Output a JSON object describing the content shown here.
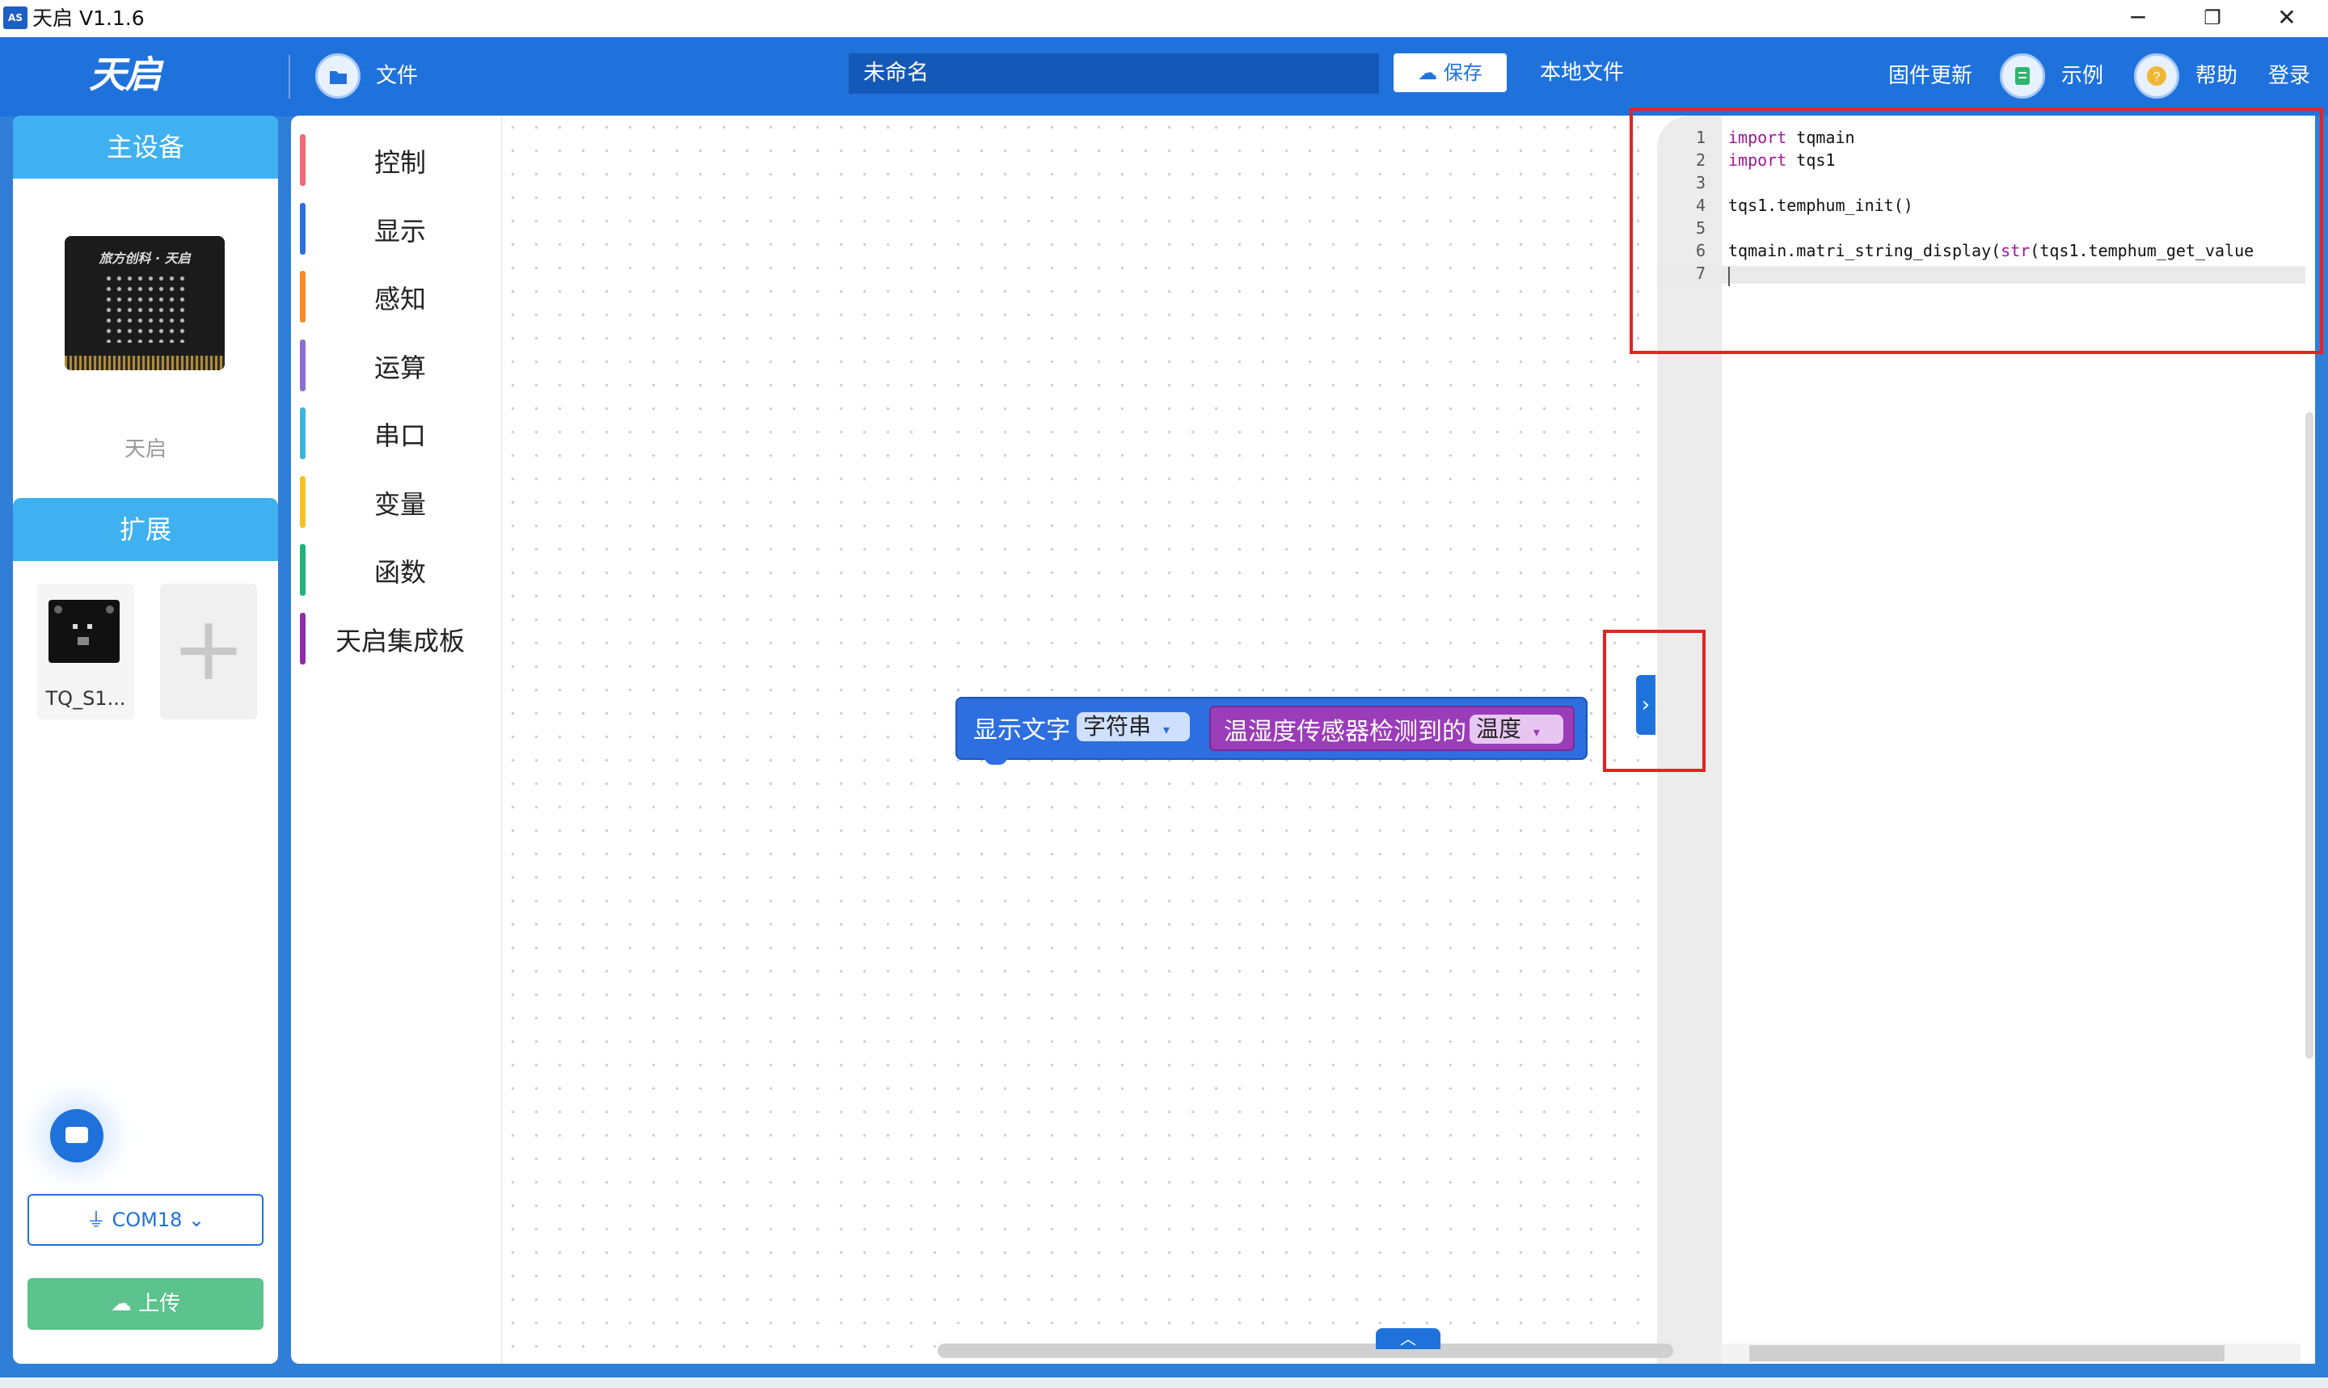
{
  "window": {
    "title": "天启 V1.1.6",
    "controls": {
      "minimize": "─",
      "maximize": "❐",
      "close": "✕"
    }
  },
  "header": {
    "logo": "天启",
    "logo_sub": "",
    "file_menu": "文件",
    "filename": "未命名",
    "save": "保存",
    "local_file": "本地文件",
    "firmware_update": "固件更新",
    "examples": "示例",
    "help": "帮助",
    "login": "登录"
  },
  "main_device": {
    "heading": "主设备",
    "board_brand": "旅方创科 · 天启",
    "name": "天启"
  },
  "extension": {
    "heading": "扩展",
    "items": [
      {
        "name": "TQ_S1..."
      }
    ],
    "add_icon": "+"
  },
  "port": {
    "selected": "COM18",
    "chevron": "⌄"
  },
  "upload": {
    "label": "上传"
  },
  "categories": [
    {
      "label": "控制",
      "color": "#f06a78"
    },
    {
      "label": "显示",
      "color": "#2d6fe0"
    },
    {
      "label": "感知",
      "color": "#f28c28"
    },
    {
      "label": "运算",
      "color": "#8a6fd1"
    },
    {
      "label": "串口",
      "color": "#3cb6d8"
    },
    {
      "label": "变量",
      "color": "#f5c025"
    },
    {
      "label": "函数",
      "color": "#1fb37a"
    },
    {
      "label": "天启集成板",
      "color": "#8e2ea4"
    }
  ],
  "block": {
    "label": "显示文字",
    "type_dropdown": "字符串",
    "value_label": "温湿度传感器检测到的",
    "value_dropdown": "温度",
    "dropdown_arrow": "▾"
  },
  "toggle": {
    "icon": "›"
  },
  "code": {
    "lines": [
      {
        "n": "1",
        "kw": "import",
        "rest": " tqmain"
      },
      {
        "n": "2",
        "kw": "import",
        "rest": " tqs1"
      },
      {
        "n": "3",
        "kw": "",
        "rest": ""
      },
      {
        "n": "4",
        "kw": "",
        "rest": "tqs1.temphum_init()"
      },
      {
        "n": "5",
        "kw": "",
        "rest": ""
      },
      {
        "n": "6",
        "kw": "",
        "rest": "tqmain.matri_string_display(",
        "kw2": "str",
        "rest2": "(tqs1.temphum_get_value"
      },
      {
        "n": "7",
        "kw": "",
        "rest": ""
      }
    ]
  },
  "workspace": {
    "scroll_up_icon": "︿"
  },
  "colors": {
    "header_bg": "#1f72dc",
    "accent": "#3fb1f0",
    "upload_green": "#5cc28e",
    "highlight_red": "#e52222",
    "block_blue": "#2d6fe0",
    "block_purple": "#9b3cb8",
    "keyword": "#a31599"
  }
}
